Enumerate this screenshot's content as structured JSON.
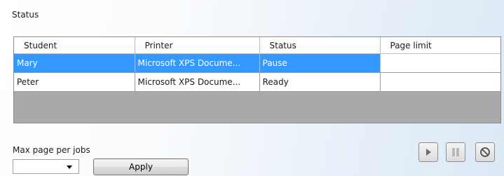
{
  "status_group": {
    "label": "Status"
  },
  "grid": {
    "columns": [
      "Student",
      "Printer",
      "Status",
      "Page limit"
    ],
    "rows": [
      {
        "student": "Mary",
        "printer": "Microsoft XPS Docume...",
        "status": "Pause",
        "page_limit": "",
        "selected": true
      },
      {
        "student": "Peter",
        "printer": "Microsoft XPS Docume...",
        "status": "Ready",
        "page_limit": "",
        "selected": false
      }
    ]
  },
  "max_page": {
    "label": "Max page per jobs",
    "value": ""
  },
  "apply_button": {
    "label": "Apply"
  },
  "controls": {
    "play_icon": "play-icon",
    "pause_icon": "pause-icon",
    "stop_icon": "block-icon"
  },
  "colors": {
    "selection": "#3399ff",
    "grid_empty": "#a9a9a9"
  }
}
